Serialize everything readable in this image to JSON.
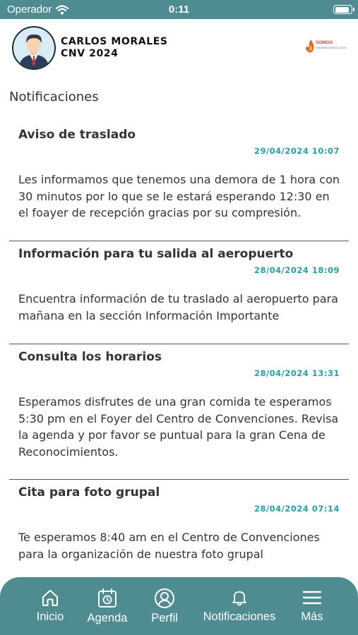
{
  "status_bar": {
    "carrier": "Operador",
    "time": "0:11"
  },
  "user": {
    "name": "CARLOS MORALES",
    "event": "CNV 2024"
  },
  "logo": {
    "text": "SOMOS",
    "subtext": "LOOKING NUEVO 2024"
  },
  "page_title": "Notificaciones",
  "notifications": [
    {
      "title": "Aviso de traslado",
      "date": "29/04/2024 10:07",
      "body": "Les informamos que tenemos una demora de 1 hora con 30 minutos por lo que se le estará esperando 12:30 en el foayer de recepción gracias por su compresión."
    },
    {
      "title": "Información para tu salida al aeropuerto",
      "date": "28/04/2024 18:09",
      "body": "Encuentra información de tu traslado al aeropuerto para mañana en la sección Información Importante"
    },
    {
      "title": "Consulta los horarios",
      "date": "28/04/2024 13:31",
      "body": "Esperamos disfrutes de una gran comida te esperamos 5:30 pm en el Foyer del Centro de Convenciones. Revisa la agenda y por favor se puntual para la gran Cena de Reconocimientos."
    },
    {
      "title": "Cita para foto grupal",
      "date": "28/04/2024 07:14",
      "body": "Te esperamos 8:40 am en el Centro de Convenciones para la organización de nuestra foto grupal"
    }
  ],
  "tabs": [
    {
      "label": "Inicio",
      "icon": "home-icon"
    },
    {
      "label": "Agenda",
      "icon": "calendar-icon"
    },
    {
      "label": "Perfil",
      "icon": "user-icon"
    },
    {
      "label": "Notificaciones",
      "icon": "bell-icon"
    },
    {
      "label": "Más",
      "icon": "menu-icon"
    }
  ],
  "colors": {
    "primary": "#4e8c91",
    "date": "#2a9dab",
    "text": "#333333"
  }
}
